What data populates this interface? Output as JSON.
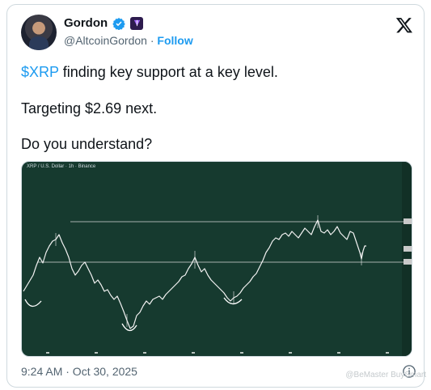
{
  "author": {
    "name": "Gordon",
    "handle": "@AltcoinGordon",
    "separator": " · ",
    "follow_label": "Follow"
  },
  "post": {
    "line1_cashtag": "$XRP",
    "line1_rest": " finding key support at a key level.",
    "line2": "Targeting $2.69 next.",
    "line3": "Do you understand?"
  },
  "chart": {
    "header": "XRP / U.S. Dollar · 1h · Binance"
  },
  "timestamp": "9:24 AM · Oct 30, 2025",
  "watermark": "@BeMaster BuySmart",
  "colors": {
    "accent": "#1d9bf0",
    "chart_bg": "#163a2f",
    "price_line": "#e8e8e8"
  },
  "icons": [
    "verified-icon",
    "affiliate-badge-icon",
    "x-logo-icon",
    "info-icon"
  ]
}
